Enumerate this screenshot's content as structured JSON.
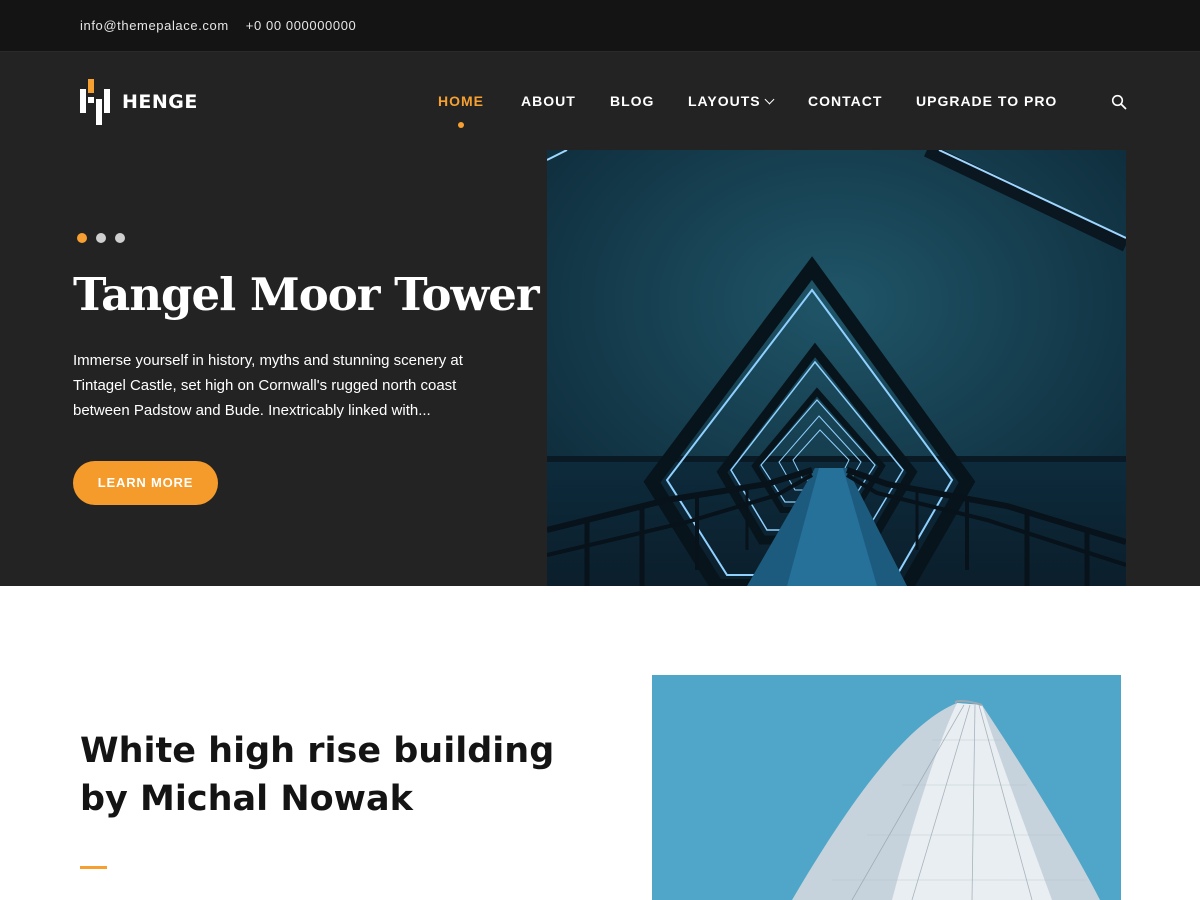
{
  "topbar": {
    "email": "info@themepalace.com",
    "phone": "+0 00 000000000"
  },
  "brand": {
    "name": "HENGE"
  },
  "nav": {
    "items": [
      {
        "label": "HOME",
        "active": true
      },
      {
        "label": "ABOUT"
      },
      {
        "label": "BLOG"
      },
      {
        "label": "LAYOUTS",
        "has_dropdown": true
      },
      {
        "label": "CONTACT"
      },
      {
        "label": "UPGRADE TO PRO"
      }
    ],
    "search_icon": "search-icon"
  },
  "slider": {
    "dots": 3,
    "active_dot": 1,
    "title": "Tangel Moor Tower",
    "text": "Immerse yourself in history, myths and stunning scenery at Tintagel Castle, set high on Cornwall's rugged north coast between Padstow and Bude. Inextricably linked with...",
    "button": "LEARN MORE"
  },
  "feature": {
    "title": "White high rise building by Michal Nowak"
  },
  "colors": {
    "accent": "#f5a031",
    "dark_bg": "#232323",
    "topbar_bg": "#141414"
  }
}
